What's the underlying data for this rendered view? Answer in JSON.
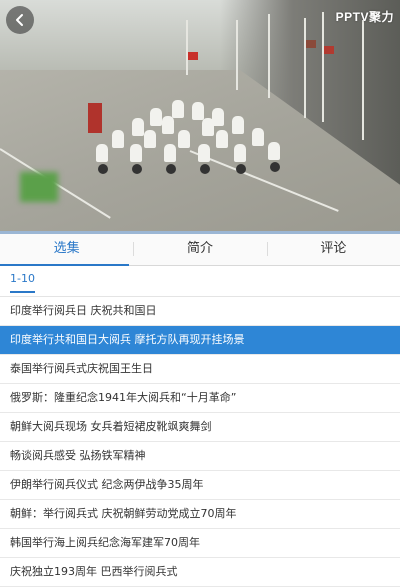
{
  "player": {
    "logo": "PPTV聚力",
    "back_icon": "chevron-left-icon",
    "colors": {
      "progress": "#9bb6d4"
    }
  },
  "tabs": [
    {
      "label": "选集",
      "active": true
    },
    {
      "label": "简介",
      "active": false
    },
    {
      "label": "评论",
      "active": false
    }
  ],
  "episode_range": "1-10",
  "episodes": [
    {
      "title": "印度举行阅兵日 庆祝共和国日",
      "selected": false
    },
    {
      "title": "印度举行共和国日大阅兵 摩托方队再现开挂场景",
      "selected": true
    },
    {
      "title": "泰国举行阅兵式庆祝国王生日",
      "selected": false
    },
    {
      "title": "俄罗斯：隆重纪念1941年大阅兵和“十月革命”",
      "selected": false
    },
    {
      "title": "朝鲜大阅兵现场 女兵着短裙皮靴飒爽舞剑",
      "selected": false
    },
    {
      "title": "畅谈阅兵感受 弘扬铁军精神",
      "selected": false
    },
    {
      "title": "伊朗举行阅兵仪式 纪念两伊战争35周年",
      "selected": false
    },
    {
      "title": "朝鲜：举行阅兵式 庆祝朝鲜劳动党成立70周年",
      "selected": false
    },
    {
      "title": "韩国举行海上阅兵纪念海军建军70周年",
      "selected": false
    },
    {
      "title": "庆祝独立193周年 巴西举行阅兵式",
      "selected": false
    }
  ],
  "colors": {
    "accent": "#2a78c8",
    "selected_bg": "#2e86d6"
  }
}
